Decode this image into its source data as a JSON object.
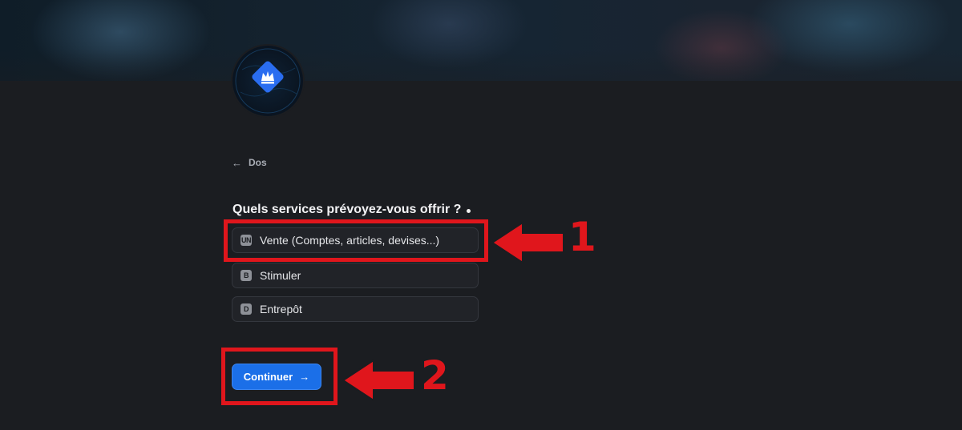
{
  "header": {
    "logo_icon": "crown-diamond-logo-icon",
    "accent": "#1b6fe8"
  },
  "nav": {
    "back_label": "Dos"
  },
  "form": {
    "question": "Quels services prévoyez-vous offrir ?",
    "options": [
      {
        "key": "UN",
        "label": "Vente (Comptes, articles, devises...)"
      },
      {
        "key": "B",
        "label": "Stimuler"
      },
      {
        "key": "D",
        "label": "Entrepôt"
      }
    ],
    "continue_label": "Continuer"
  },
  "annotations": {
    "step1": "1",
    "step2": "2",
    "color": "#e0161c"
  }
}
